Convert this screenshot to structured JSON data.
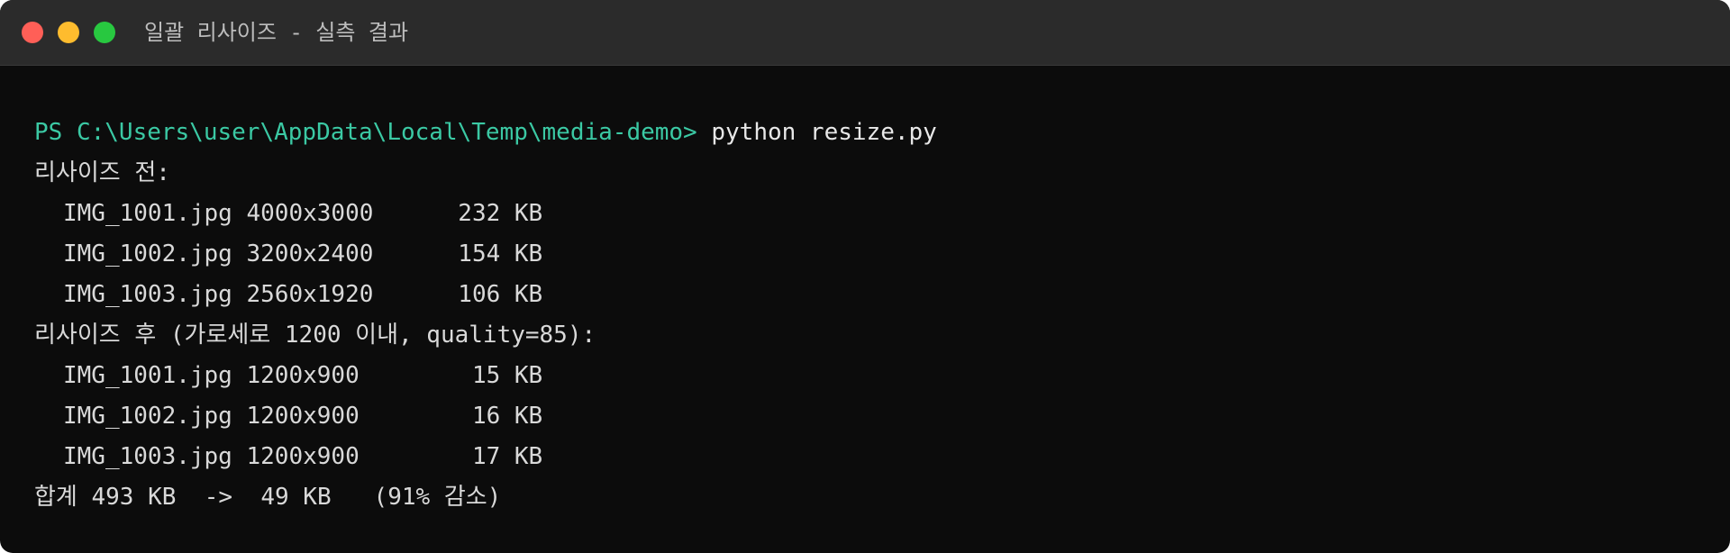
{
  "window": {
    "title": "일괄 리사이즈 - 실측 결과"
  },
  "terminal": {
    "prompt": "PS C:\\Users\\user\\AppData\\Local\\Temp\\media-demo> ",
    "command": "python resize.py",
    "before_header": "리사이즈 전:",
    "before_rows": [
      "IMG_1001.jpg 4000x3000      232 KB",
      "IMG_1002.jpg 3200x2400      154 KB",
      "IMG_1003.jpg 2560x1920      106 KB"
    ],
    "after_header": "리사이즈 후 (가로세로 1200 이내, quality=85):",
    "after_rows": [
      "IMG_1001.jpg 1200x900        15 KB",
      "IMG_1002.jpg 1200x900        16 KB",
      "IMG_1003.jpg 1200x900        17 KB"
    ],
    "summary": "합계 493 KB  ->  49 KB   (91% 감소)"
  },
  "colors": {
    "close": "#ff5f57",
    "minimize": "#febc2e",
    "maximize": "#28c840",
    "prompt": "#3bc9a4",
    "background": "#0c0c0c",
    "titlebar": "#2b2b2b",
    "text": "#d9d9d9"
  }
}
